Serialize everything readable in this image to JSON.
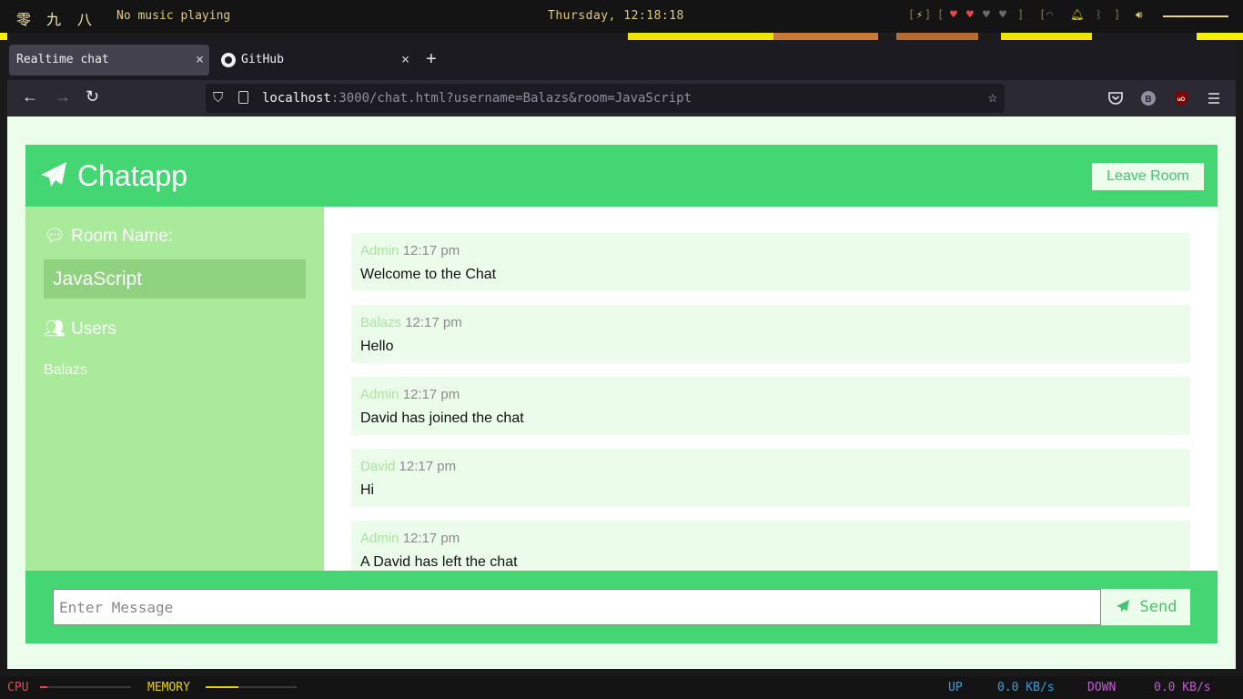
{
  "topbar": {
    "workspaces": [
      "零",
      "九",
      "八"
    ],
    "music": "No music playing",
    "clock": "Thursday, 12:18:18",
    "tray_bracket_open": "[",
    "tray_bracket_close": "]"
  },
  "browser": {
    "tabs": [
      {
        "label": "Realtime chat",
        "close": "×"
      },
      {
        "label": "GitHub",
        "close": "×"
      }
    ],
    "new_tab": "+",
    "url": {
      "host": "localhost",
      "rest": ":3000/chat.html?username=Balazs&room=JavaScript"
    }
  },
  "app": {
    "title": "Chatapp",
    "leave_button": "Leave Room",
    "sidebar": {
      "room_heading": "Room Name:",
      "room_name": "JavaScript",
      "users_heading": "Users",
      "users": [
        "Balazs"
      ]
    },
    "messages": [
      {
        "name": "Admin",
        "time": "12:17 pm",
        "text": "Welcome to the Chat"
      },
      {
        "name": "Balazs",
        "time": "12:17 pm",
        "text": "Hello"
      },
      {
        "name": "Admin",
        "time": "12:17 pm",
        "text": "David has joined the chat"
      },
      {
        "name": "David",
        "time": "12:17 pm",
        "text": "Hi"
      },
      {
        "name": "Admin",
        "time": "12:17 pm",
        "text": "A David has left the chat"
      }
    ],
    "composer": {
      "placeholder": "Enter Message",
      "send_label": "Send"
    }
  },
  "statusbar": {
    "cpu_label": "CPU",
    "cpu_level": 0.08,
    "memory_label": "MEMORY",
    "memory_level": 0.36,
    "up_label": "UP",
    "up_value": "0.0 KB/s",
    "down_label": "DOWN",
    "down_value": "0.0 KB/s"
  },
  "colors": {
    "accent": "#44d673",
    "sidebar": "#a9eb9b",
    "page_bg": "#ecfdec",
    "cpu": "#e5484d",
    "memory": "#e8d000",
    "net": "#3aa0e0",
    "down": "#c45ad6"
  }
}
